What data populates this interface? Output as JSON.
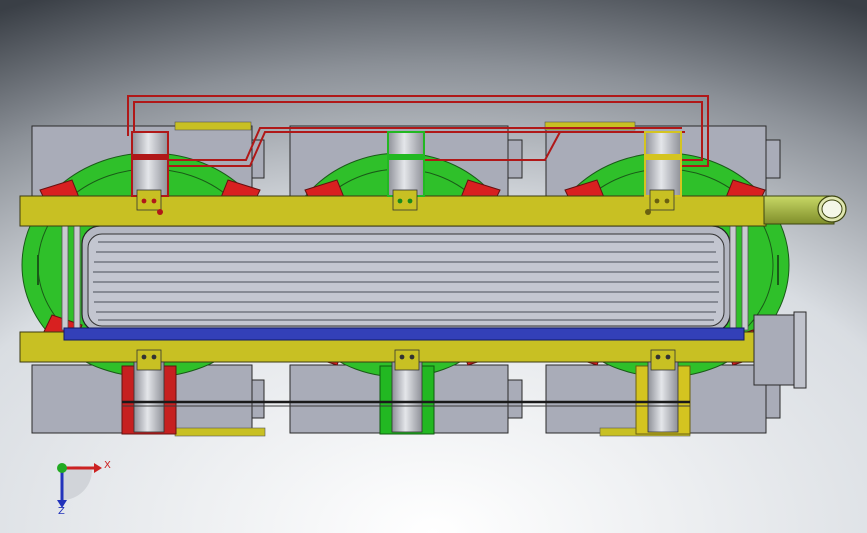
{
  "view": {
    "background_top": "#3c4148",
    "background_bottom": "#f4f6f8"
  },
  "colors": {
    "box_gray": "#a9acb8",
    "box_edge": "#2a2a2a",
    "rail_yellow": "#c8c023",
    "coil_green": "#2fc02a",
    "pole_red": "#d82020",
    "silver": "#c8cad0",
    "blue_bar": "#3340b8",
    "lead_red": "#b01818",
    "tube_green": "#a6b840",
    "cap_red": "#c62020",
    "cap_green": "#22b822",
    "cap_yellow": "#d4c420"
  },
  "triad": {
    "x_label": "X",
    "z_label": "Z",
    "x_color": "#cc2222",
    "z_color": "#2233bb",
    "y_color": "#22aa22"
  }
}
